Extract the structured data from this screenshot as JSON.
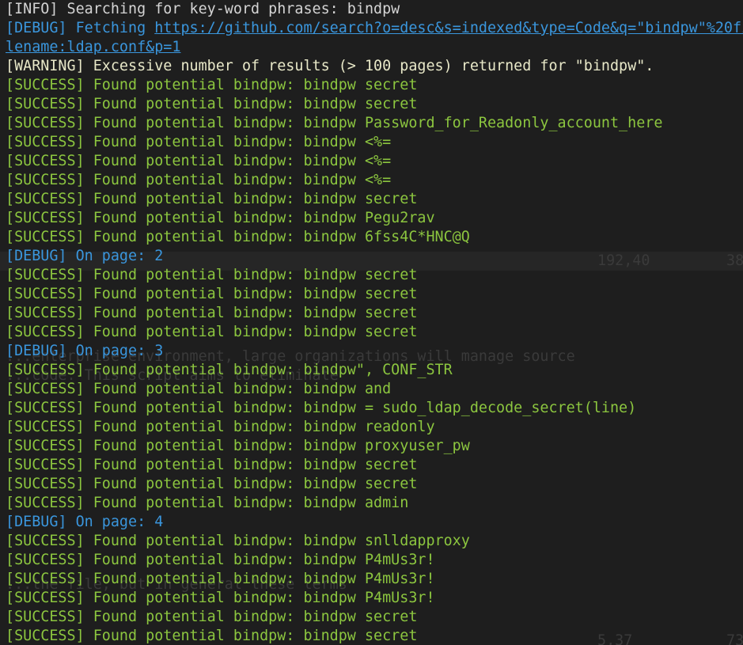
{
  "background_text": {
    "cursor_pos": "192,40",
    "pos_right": "38",
    "line_a": "...enterprise environment, large organizations will manage source",
    "line_b": "...code. This script aims to eliminate",
    "line_c": "...the file, but in general these terms",
    "pos_bottom_a": "5,37",
    "pos_bottom_b": "73"
  },
  "log": [
    {
      "level": "info",
      "text": "[INFO] Searching for key-word phrases: bindpw"
    },
    {
      "level": "debug",
      "text": "[DEBUG] Fetching https://github.com/search?o=desc&s=indexed&type=Code&q=\"bindpw\"%20fi"
    },
    {
      "level": "debug",
      "text": "lename:ldap.conf&p=1"
    },
    {
      "level": "warning",
      "text": "[WARNING] Excessive number of results (> 100 pages) returned for \"bindpw\"."
    },
    {
      "level": "success",
      "text": "[SUCCESS] Found potential bindpw: bindpw secret"
    },
    {
      "level": "success",
      "text": "[SUCCESS] Found potential bindpw: bindpw secret"
    },
    {
      "level": "success",
      "text": "[SUCCESS] Found potential bindpw: bindpw Password_for_Readonly_account_here"
    },
    {
      "level": "success",
      "text": "[SUCCESS] Found potential bindpw: bindpw <%="
    },
    {
      "level": "success",
      "text": "[SUCCESS] Found potential bindpw: bindpw <%="
    },
    {
      "level": "success",
      "text": "[SUCCESS] Found potential bindpw: bindpw <%="
    },
    {
      "level": "success",
      "text": "[SUCCESS] Found potential bindpw: bindpw secret"
    },
    {
      "level": "success",
      "text": "[SUCCESS] Found potential bindpw: bindpw Pegu2rav"
    },
    {
      "level": "success",
      "text": "[SUCCESS] Found potential bindpw: bindpw 6fss4C*HNC@Q"
    },
    {
      "level": "debug",
      "text": "[DEBUG] On page: 2"
    },
    {
      "level": "success",
      "text": "[SUCCESS] Found potential bindpw: bindpw secret"
    },
    {
      "level": "success",
      "text": "[SUCCESS] Found potential bindpw: bindpw secret"
    },
    {
      "level": "success",
      "text": "[SUCCESS] Found potential bindpw: bindpw secret"
    },
    {
      "level": "success",
      "text": "[SUCCESS] Found potential bindpw: bindpw secret"
    },
    {
      "level": "debug",
      "text": "[DEBUG] On page: 3"
    },
    {
      "level": "success",
      "text": "[SUCCESS] Found potential bindpw: bindpw\", CONF_STR"
    },
    {
      "level": "success",
      "text": "[SUCCESS] Found potential bindpw: bindpw and"
    },
    {
      "level": "success",
      "text": "[SUCCESS] Found potential bindpw: bindpw = sudo_ldap_decode_secret(line)"
    },
    {
      "level": "success",
      "text": "[SUCCESS] Found potential bindpw: bindpw readonly"
    },
    {
      "level": "success",
      "text": "[SUCCESS] Found potential bindpw: bindpw proxyuser_pw"
    },
    {
      "level": "success",
      "text": "[SUCCESS] Found potential bindpw: bindpw secret"
    },
    {
      "level": "success",
      "text": "[SUCCESS] Found potential bindpw: bindpw secret"
    },
    {
      "level": "success",
      "text": "[SUCCESS] Found potential bindpw: bindpw admin"
    },
    {
      "level": "debug",
      "text": "[DEBUG] On page: 4"
    },
    {
      "level": "success",
      "text": "[SUCCESS] Found potential bindpw: bindpw snlldapproxy"
    },
    {
      "level": "success",
      "text": "[SUCCESS] Found potential bindpw: bindpw P4mUs3r!"
    },
    {
      "level": "success",
      "text": "[SUCCESS] Found potential bindpw: bindpw P4mUs3r!"
    },
    {
      "level": "success",
      "text": "[SUCCESS] Found potential bindpw: bindpw P4mUs3r!"
    },
    {
      "level": "success",
      "text": "[SUCCESS] Found potential bindpw: bindpw secret"
    },
    {
      "level": "success",
      "text": "[SUCCESS] Found potential bindpw: bindpw secret"
    }
  ],
  "colors": {
    "background": "#1e1e1e",
    "info": "#d4d4d4",
    "warning": "#e8e8c8",
    "success": "#8cc63f",
    "debug": "#3a96dd"
  }
}
